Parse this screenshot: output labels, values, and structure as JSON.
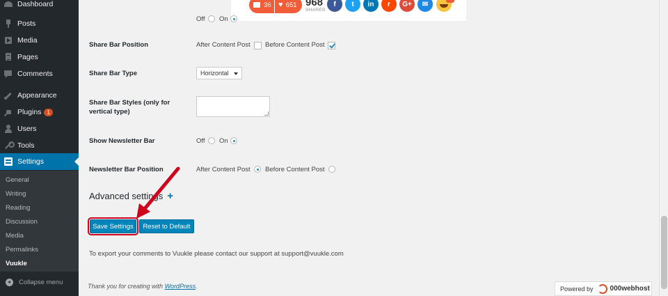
{
  "sidebar": {
    "dashboard": "Dashboard",
    "items": [
      {
        "label": "Posts"
      },
      {
        "label": "Media"
      },
      {
        "label": "Pages"
      },
      {
        "label": "Comments"
      },
      {
        "label": "Appearance"
      },
      {
        "label": "Plugins",
        "badge": "1"
      },
      {
        "label": "Users"
      },
      {
        "label": "Tools"
      },
      {
        "label": "Settings"
      }
    ],
    "submenu": [
      "General",
      "Writing",
      "Reading",
      "Discussion",
      "Media",
      "Permalinks",
      "Vuukle"
    ],
    "collapse": "Collapse menu"
  },
  "preview": {
    "comments_count": "36",
    "likes_count": "651",
    "shares_count": "968",
    "shares_label": "SHARES",
    "social": [
      {
        "icon": "facebook-icon",
        "glyph": "f",
        "color": "#3b5998"
      },
      {
        "icon": "twitter-icon",
        "glyph": "t",
        "color": "#1da1f2"
      },
      {
        "icon": "linkedin-icon",
        "glyph": "in",
        "color": "#0077b5"
      },
      {
        "icon": "reddit-icon",
        "glyph": "r",
        "color": "#ff4500"
      },
      {
        "icon": "googleplus-icon",
        "glyph": "G+",
        "color": "#dd4b39"
      },
      {
        "icon": "email-icon",
        "glyph": "✉",
        "color": "#1e88e5"
      }
    ]
  },
  "settings": {
    "top_off": "Off",
    "top_on": "On",
    "share_bar_position": {
      "label": "Share Bar Position",
      "after": "After Content Post",
      "before": "Before Content Post"
    },
    "share_bar_type": {
      "label": "Share Bar Type",
      "value": "Horizontal"
    },
    "share_bar_styles": {
      "label_line1": "Share Bar Styles (only for",
      "label_line2": "vertical type)"
    },
    "show_newsletter": {
      "label": "Show Newsletter Bar",
      "off": "Off",
      "on": "On"
    },
    "newsletter_position": {
      "label": "Newsletter Bar Position",
      "after": "After Content Post",
      "before": "Before Content Post"
    },
    "advanced": "Advanced settings",
    "advanced_plus": "+"
  },
  "buttons": {
    "save": "Save Settings",
    "reset": "Reset to Default"
  },
  "export_text": "To export your comments to Vuukle please contact our support at support@vuukle.com",
  "footer": {
    "prefix": "Thank you for creating with ",
    "link": "WordPress",
    "suffix": "."
  },
  "powered": {
    "label": "Powered by",
    "brand": "000webhost"
  },
  "colors": {
    "accent": "#0073aa",
    "button": "#0085ba",
    "highlight_border": "#d0021b",
    "share_orange": "#f25c38"
  }
}
